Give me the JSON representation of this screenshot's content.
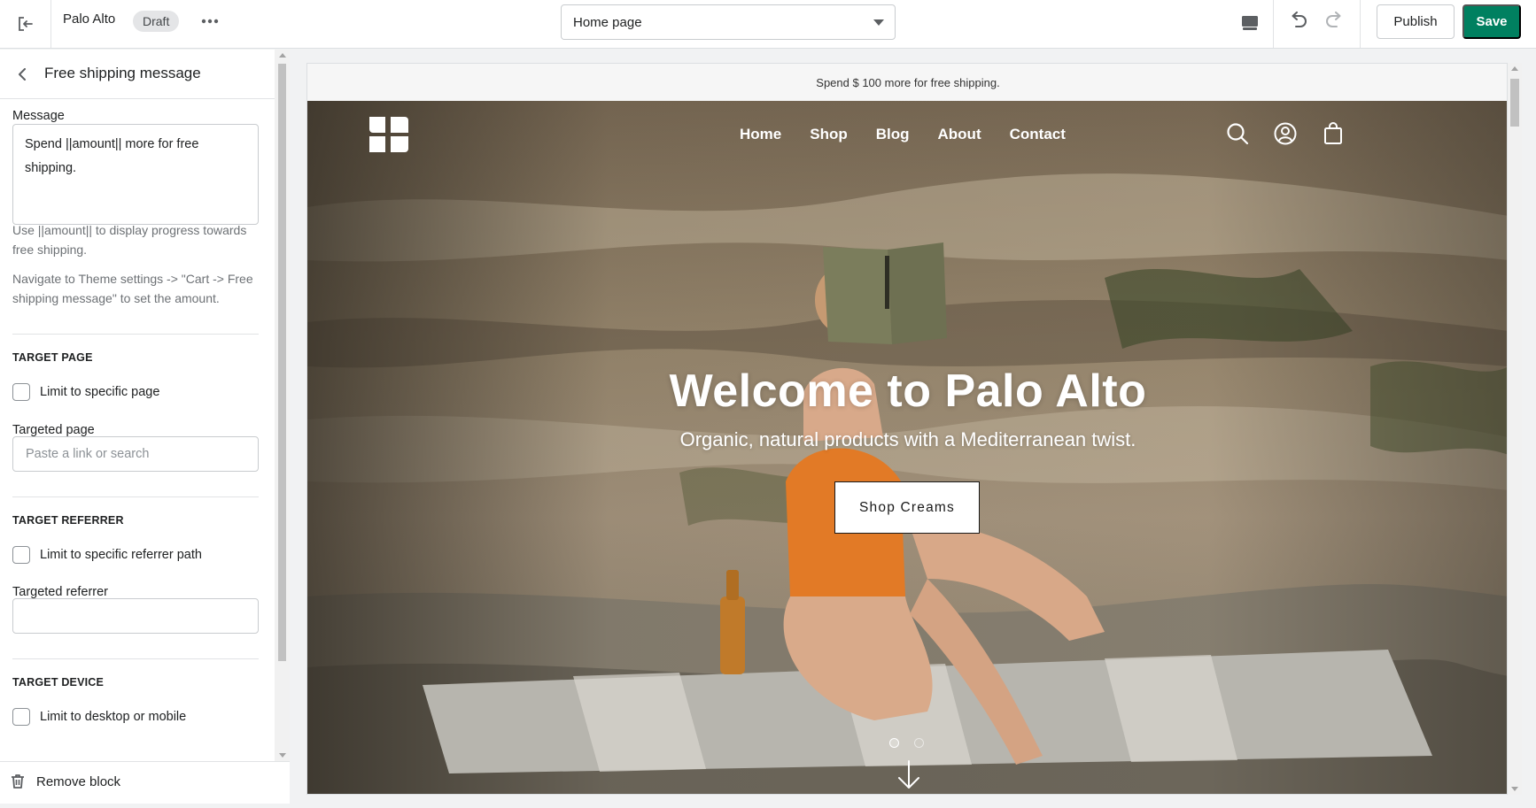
{
  "topbar": {
    "store_name": "Palo Alto",
    "status_badge": "Draft",
    "more_label": "•••",
    "page_select_value": "Home page",
    "publish_label": "Publish",
    "save_label": "Save"
  },
  "panel": {
    "title": "Free shipping message",
    "message_label": "Message",
    "message_value": "Spend ||amount|| more for free shipping.",
    "help_amount": "Use ||amount|| to display progress towards free shipping.",
    "help_navigate": "Navigate to Theme settings -> \"Cart -> Free shipping message\" to set the amount.",
    "sections": {
      "target_page": {
        "heading": "TARGET PAGE",
        "checkbox_label": "Limit to specific page",
        "field_label": "Targeted page",
        "field_placeholder": "Paste a link or search"
      },
      "target_referrer": {
        "heading": "TARGET REFERRER",
        "checkbox_label": "Limit to specific referrer path",
        "field_label": "Targeted referrer",
        "field_value": ""
      },
      "target_device": {
        "heading": "TARGET DEVICE",
        "checkbox_label": "Limit to desktop or mobile"
      }
    },
    "remove_block_label": "Remove block"
  },
  "preview": {
    "announcement": "Spend $ 100 more for free shipping.",
    "nav_links": [
      "Home",
      "Shop",
      "Blog",
      "About",
      "Contact"
    ],
    "hero_title": "Welcome to Palo Alto",
    "hero_subtitle": "Organic, natural products with a Mediterranean twist.",
    "hero_cta": "Shop Creams",
    "slide_count": 2,
    "active_slide": 1
  },
  "icons": {
    "exit": "exit-icon",
    "device": "desktop-icon",
    "undo": "undo-icon",
    "redo": "redo-icon",
    "back": "chevron-left-icon",
    "trash": "trash-icon",
    "search": "search-icon",
    "account": "account-icon",
    "cart": "shopping-bag-icon"
  },
  "colors": {
    "save_button": "#008060",
    "panel_bg": "#ffffff",
    "app_bg": "#f1f2f3"
  }
}
